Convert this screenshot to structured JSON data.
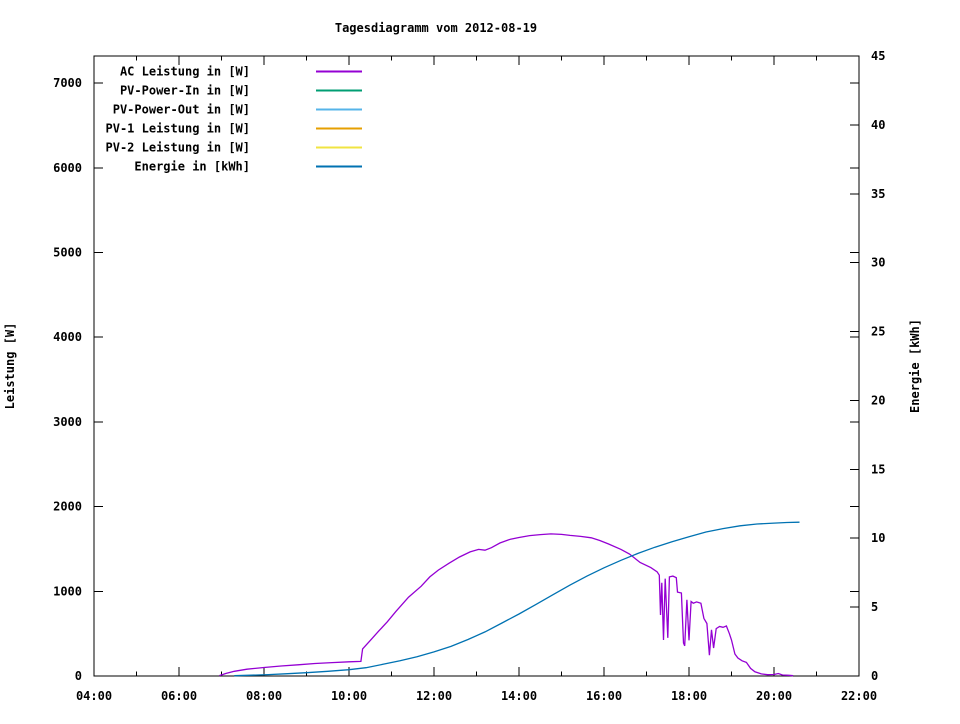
{
  "chart_data": {
    "type": "line",
    "title": "Tagesdiagramm vom 2012-08-19",
    "grid": false,
    "legend_position": "top-left-inside",
    "x_axis": {
      "start_hour": 4,
      "end_hour": 22,
      "major_step_hours": 2,
      "minor_step_hours": 1,
      "labels": [
        "04:00",
        "06:00",
        "08:00",
        "10:00",
        "12:00",
        "14:00",
        "16:00",
        "18:00",
        "20:00",
        "22:00"
      ]
    },
    "y_left": {
      "label": "Leistung [W]",
      "ticks": [
        0,
        1000,
        2000,
        3000,
        4000,
        5000,
        6000,
        7000
      ],
      "tick_labels": [
        "0",
        "1000",
        "2000",
        "3000",
        "4000",
        "5000",
        "6000",
        "7000"
      ],
      "axis_top_value": 7320
    },
    "y_right": {
      "label": "Energie [kWh]",
      "ticks": [
        0,
        5,
        10,
        15,
        20,
        25,
        30,
        35,
        40,
        45
      ],
      "tick_labels": [
        "0",
        "5",
        "10",
        "15",
        "20",
        "25",
        "30",
        "35",
        "40",
        "45"
      ],
      "axis_top_value": 45
    },
    "series": [
      {
        "name": "AC Leistung in [W]",
        "color": "#9400d3",
        "axis": "left",
        "points": [
          [
            6.95,
            5
          ],
          [
            7.1,
            30
          ],
          [
            7.3,
            55
          ],
          [
            7.6,
            80
          ],
          [
            8.0,
            100
          ],
          [
            8.4,
            118
          ],
          [
            8.8,
            132
          ],
          [
            9.2,
            148
          ],
          [
            9.6,
            158
          ],
          [
            10.0,
            168
          ],
          [
            10.28,
            172
          ],
          [
            10.32,
            320
          ],
          [
            10.5,
            420
          ],
          [
            10.7,
            530
          ],
          [
            10.9,
            640
          ],
          [
            11.1,
            760
          ],
          [
            11.4,
            930
          ],
          [
            11.7,
            1060
          ],
          [
            11.9,
            1170
          ],
          [
            12.1,
            1250
          ],
          [
            12.35,
            1330
          ],
          [
            12.6,
            1405
          ],
          [
            12.85,
            1465
          ],
          [
            13.05,
            1495
          ],
          [
            13.2,
            1485
          ],
          [
            13.35,
            1515
          ],
          [
            13.55,
            1570
          ],
          [
            13.8,
            1615
          ],
          [
            14.0,
            1635
          ],
          [
            14.25,
            1658
          ],
          [
            14.5,
            1670
          ],
          [
            14.75,
            1678
          ],
          [
            15.0,
            1672
          ],
          [
            15.2,
            1660
          ],
          [
            15.45,
            1648
          ],
          [
            15.7,
            1632
          ],
          [
            15.9,
            1600
          ],
          [
            16.1,
            1560
          ],
          [
            16.4,
            1495
          ],
          [
            16.6,
            1440
          ],
          [
            16.85,
            1340
          ],
          [
            17.1,
            1280
          ],
          [
            17.25,
            1230
          ],
          [
            17.3,
            1190
          ],
          [
            17.33,
            720
          ],
          [
            17.36,
            1100
          ],
          [
            17.4,
            425
          ],
          [
            17.44,
            1150
          ],
          [
            17.5,
            450
          ],
          [
            17.54,
            1170
          ],
          [
            17.62,
            1180
          ],
          [
            17.7,
            1160
          ],
          [
            17.73,
            990
          ],
          [
            17.82,
            980
          ],
          [
            17.87,
            390
          ],
          [
            17.9,
            355
          ],
          [
            17.95,
            900
          ],
          [
            18.0,
            420
          ],
          [
            18.05,
            880
          ],
          [
            18.1,
            860
          ],
          [
            18.18,
            875
          ],
          [
            18.28,
            860
          ],
          [
            18.35,
            680
          ],
          [
            18.42,
            620
          ],
          [
            18.48,
            245
          ],
          [
            18.53,
            545
          ],
          [
            18.58,
            330
          ],
          [
            18.64,
            560
          ],
          [
            18.72,
            585
          ],
          [
            18.8,
            575
          ],
          [
            18.88,
            590
          ],
          [
            18.95,
            500
          ],
          [
            19.0,
            425
          ],
          [
            19.08,
            260
          ],
          [
            19.15,
            212
          ],
          [
            19.25,
            180
          ],
          [
            19.35,
            160
          ],
          [
            19.45,
            90
          ],
          [
            19.55,
            50
          ],
          [
            19.7,
            25
          ],
          [
            19.85,
            15
          ],
          [
            20.0,
            18
          ],
          [
            20.1,
            30
          ],
          [
            20.2,
            12
          ],
          [
            20.35,
            8
          ],
          [
            20.45,
            3
          ]
        ]
      },
      {
        "name": "PV-Power-In in [W]",
        "color": "#009e73",
        "axis": "left",
        "points": []
      },
      {
        "name": "PV-Power-Out in [W]",
        "color": "#56b4e9",
        "axis": "left",
        "points": []
      },
      {
        "name": "PV-1 Leistung in [W]",
        "color": "#e69f00",
        "axis": "left",
        "points": []
      },
      {
        "name": "PV-2 Leistung in [W]",
        "color": "#f0e442",
        "axis": "left",
        "points": []
      },
      {
        "name": "Energie in [kWh]",
        "color": "#0072b2",
        "axis": "right",
        "points": [
          [
            7.3,
            0.02
          ],
          [
            7.7,
            0.06
          ],
          [
            8.1,
            0.1
          ],
          [
            8.5,
            0.16
          ],
          [
            9.0,
            0.24
          ],
          [
            9.5,
            0.34
          ],
          [
            10.0,
            0.46
          ],
          [
            10.4,
            0.6
          ],
          [
            10.8,
            0.85
          ],
          [
            11.2,
            1.1
          ],
          [
            11.6,
            1.4
          ],
          [
            12.0,
            1.75
          ],
          [
            12.4,
            2.15
          ],
          [
            12.8,
            2.65
          ],
          [
            13.2,
            3.2
          ],
          [
            13.6,
            3.85
          ],
          [
            14.0,
            4.5
          ],
          [
            14.4,
            5.2
          ],
          [
            14.8,
            5.9
          ],
          [
            15.2,
            6.6
          ],
          [
            15.6,
            7.25
          ],
          [
            16.0,
            7.85
          ],
          [
            16.4,
            8.4
          ],
          [
            16.8,
            8.9
          ],
          [
            17.2,
            9.35
          ],
          [
            17.6,
            9.75
          ],
          [
            18.0,
            10.1
          ],
          [
            18.4,
            10.45
          ],
          [
            18.8,
            10.7
          ],
          [
            19.2,
            10.9
          ],
          [
            19.6,
            11.03
          ],
          [
            20.0,
            11.1
          ],
          [
            20.3,
            11.14
          ],
          [
            20.6,
            11.16
          ]
        ]
      }
    ],
    "colors": {
      "foreground": "#000000",
      "background": "#ffffff"
    }
  }
}
